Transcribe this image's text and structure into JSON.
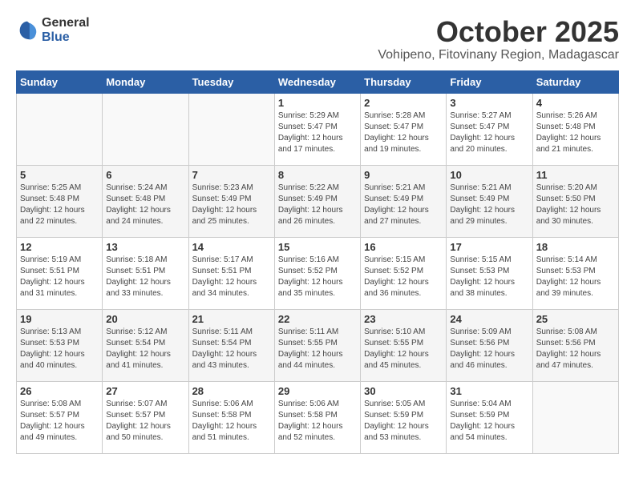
{
  "logo": {
    "general": "General",
    "blue": "Blue"
  },
  "title": "October 2025",
  "location": "Vohipeno, Fitovinany Region, Madagascar",
  "weekdays": [
    "Sunday",
    "Monday",
    "Tuesday",
    "Wednesday",
    "Thursday",
    "Friday",
    "Saturday"
  ],
  "weeks": [
    [
      {
        "day": "",
        "sunrise": "",
        "sunset": "",
        "daylight": ""
      },
      {
        "day": "",
        "sunrise": "",
        "sunset": "",
        "daylight": ""
      },
      {
        "day": "",
        "sunrise": "",
        "sunset": "",
        "daylight": ""
      },
      {
        "day": "1",
        "sunrise": "Sunrise: 5:29 AM",
        "sunset": "Sunset: 5:47 PM",
        "daylight": "Daylight: 12 hours and 17 minutes."
      },
      {
        "day": "2",
        "sunrise": "Sunrise: 5:28 AM",
        "sunset": "Sunset: 5:47 PM",
        "daylight": "Daylight: 12 hours and 19 minutes."
      },
      {
        "day": "3",
        "sunrise": "Sunrise: 5:27 AM",
        "sunset": "Sunset: 5:47 PM",
        "daylight": "Daylight: 12 hours and 20 minutes."
      },
      {
        "day": "4",
        "sunrise": "Sunrise: 5:26 AM",
        "sunset": "Sunset: 5:48 PM",
        "daylight": "Daylight: 12 hours and 21 minutes."
      }
    ],
    [
      {
        "day": "5",
        "sunrise": "Sunrise: 5:25 AM",
        "sunset": "Sunset: 5:48 PM",
        "daylight": "Daylight: 12 hours and 22 minutes."
      },
      {
        "day": "6",
        "sunrise": "Sunrise: 5:24 AM",
        "sunset": "Sunset: 5:48 PM",
        "daylight": "Daylight: 12 hours and 24 minutes."
      },
      {
        "day": "7",
        "sunrise": "Sunrise: 5:23 AM",
        "sunset": "Sunset: 5:49 PM",
        "daylight": "Daylight: 12 hours and 25 minutes."
      },
      {
        "day": "8",
        "sunrise": "Sunrise: 5:22 AM",
        "sunset": "Sunset: 5:49 PM",
        "daylight": "Daylight: 12 hours and 26 minutes."
      },
      {
        "day": "9",
        "sunrise": "Sunrise: 5:21 AM",
        "sunset": "Sunset: 5:49 PM",
        "daylight": "Daylight: 12 hours and 27 minutes."
      },
      {
        "day": "10",
        "sunrise": "Sunrise: 5:21 AM",
        "sunset": "Sunset: 5:49 PM",
        "daylight": "Daylight: 12 hours and 29 minutes."
      },
      {
        "day": "11",
        "sunrise": "Sunrise: 5:20 AM",
        "sunset": "Sunset: 5:50 PM",
        "daylight": "Daylight: 12 hours and 30 minutes."
      }
    ],
    [
      {
        "day": "12",
        "sunrise": "Sunrise: 5:19 AM",
        "sunset": "Sunset: 5:51 PM",
        "daylight": "Daylight: 12 hours and 31 minutes."
      },
      {
        "day": "13",
        "sunrise": "Sunrise: 5:18 AM",
        "sunset": "Sunset: 5:51 PM",
        "daylight": "Daylight: 12 hours and 33 minutes."
      },
      {
        "day": "14",
        "sunrise": "Sunrise: 5:17 AM",
        "sunset": "Sunset: 5:51 PM",
        "daylight": "Daylight: 12 hours and 34 minutes."
      },
      {
        "day": "15",
        "sunrise": "Sunrise: 5:16 AM",
        "sunset": "Sunset: 5:52 PM",
        "daylight": "Daylight: 12 hours and 35 minutes."
      },
      {
        "day": "16",
        "sunrise": "Sunrise: 5:15 AM",
        "sunset": "Sunset: 5:52 PM",
        "daylight": "Daylight: 12 hours and 36 minutes."
      },
      {
        "day": "17",
        "sunrise": "Sunrise: 5:15 AM",
        "sunset": "Sunset: 5:53 PM",
        "daylight": "Daylight: 12 hours and 38 minutes."
      },
      {
        "day": "18",
        "sunrise": "Sunrise: 5:14 AM",
        "sunset": "Sunset: 5:53 PM",
        "daylight": "Daylight: 12 hours and 39 minutes."
      }
    ],
    [
      {
        "day": "19",
        "sunrise": "Sunrise: 5:13 AM",
        "sunset": "Sunset: 5:53 PM",
        "daylight": "Daylight: 12 hours and 40 minutes."
      },
      {
        "day": "20",
        "sunrise": "Sunrise: 5:12 AM",
        "sunset": "Sunset: 5:54 PM",
        "daylight": "Daylight: 12 hours and 41 minutes."
      },
      {
        "day": "21",
        "sunrise": "Sunrise: 5:11 AM",
        "sunset": "Sunset: 5:54 PM",
        "daylight": "Daylight: 12 hours and 43 minutes."
      },
      {
        "day": "22",
        "sunrise": "Sunrise: 5:11 AM",
        "sunset": "Sunset: 5:55 PM",
        "daylight": "Daylight: 12 hours and 44 minutes."
      },
      {
        "day": "23",
        "sunrise": "Sunrise: 5:10 AM",
        "sunset": "Sunset: 5:55 PM",
        "daylight": "Daylight: 12 hours and 45 minutes."
      },
      {
        "day": "24",
        "sunrise": "Sunrise: 5:09 AM",
        "sunset": "Sunset: 5:56 PM",
        "daylight": "Daylight: 12 hours and 46 minutes."
      },
      {
        "day": "25",
        "sunrise": "Sunrise: 5:08 AM",
        "sunset": "Sunset: 5:56 PM",
        "daylight": "Daylight: 12 hours and 47 minutes."
      }
    ],
    [
      {
        "day": "26",
        "sunrise": "Sunrise: 5:08 AM",
        "sunset": "Sunset: 5:57 PM",
        "daylight": "Daylight: 12 hours and 49 minutes."
      },
      {
        "day": "27",
        "sunrise": "Sunrise: 5:07 AM",
        "sunset": "Sunset: 5:57 PM",
        "daylight": "Daylight: 12 hours and 50 minutes."
      },
      {
        "day": "28",
        "sunrise": "Sunrise: 5:06 AM",
        "sunset": "Sunset: 5:58 PM",
        "daylight": "Daylight: 12 hours and 51 minutes."
      },
      {
        "day": "29",
        "sunrise": "Sunrise: 5:06 AM",
        "sunset": "Sunset: 5:58 PM",
        "daylight": "Daylight: 12 hours and 52 minutes."
      },
      {
        "day": "30",
        "sunrise": "Sunrise: 5:05 AM",
        "sunset": "Sunset: 5:59 PM",
        "daylight": "Daylight: 12 hours and 53 minutes."
      },
      {
        "day": "31",
        "sunrise": "Sunrise: 5:04 AM",
        "sunset": "Sunset: 5:59 PM",
        "daylight": "Daylight: 12 hours and 54 minutes."
      },
      {
        "day": "",
        "sunrise": "",
        "sunset": "",
        "daylight": ""
      }
    ]
  ]
}
